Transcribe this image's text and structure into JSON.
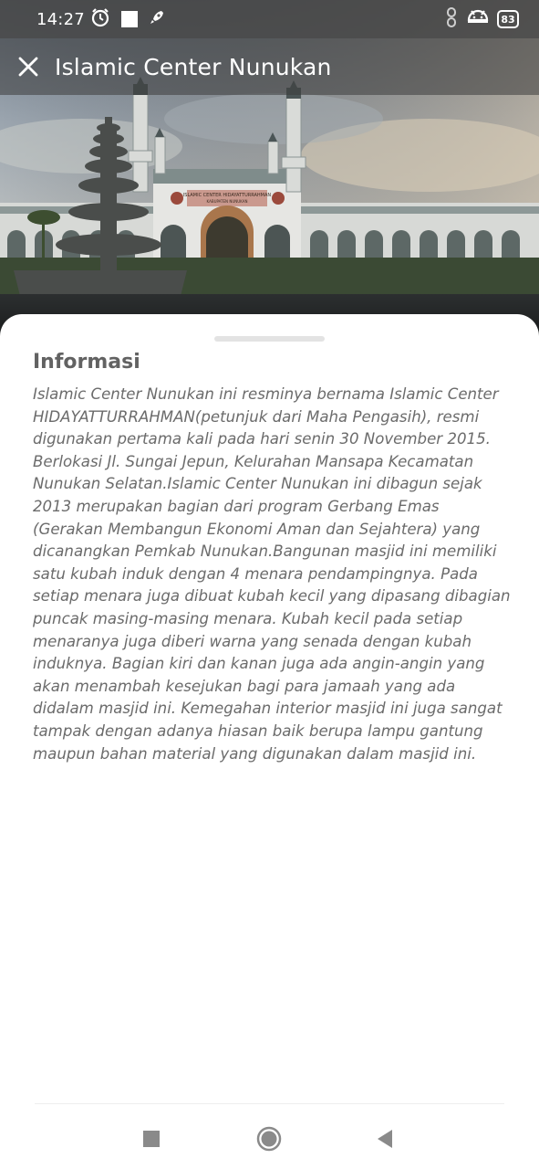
{
  "status_bar": {
    "time": "14:27",
    "icons": [
      "alarm-icon",
      "square-notification-icon",
      "rocket-icon",
      "link-icon",
      "android-icon"
    ],
    "battery": "83"
  },
  "app_bar": {
    "title": "Islamic Center Nunukan",
    "close_icon": "close-icon"
  },
  "hero": {
    "description": "photo of Islamic Center Nunukan mosque with fountain",
    "sign_text_1": "ISLAMIC CENTER HIDAYATTURRAHMAN",
    "sign_text_2": "KABUPATEN NUNUKAN"
  },
  "sheet": {
    "section_title": "Informasi",
    "body": "Islamic Center Nunukan ini resminya bernama Islamic Center HIDAYATTURRAHMAN(petunjuk dari Maha Pengasih), resmi digunakan pertama kali pada hari senin 30 November 2015. Berlokasi Jl. Sungai Jepun, Kelurahan Mansapa Kecamatan Nunukan Selatan.Islamic Center Nunukan ini dibagun sejak 2013 merupakan bagian dari program Gerbang Emas (Gerakan Membangun Ekonomi Aman dan Sejahtera) yang dicanangkan Pemkab Nunukan.Bangunan masjid ini memiliki satu kubah induk dengan 4 menara pendampingnya. Pada setiap menara juga dibuat kubah kecil yang dipasang dibagian puncak masing-masing menara. Kubah kecil pada setiap menaranya juga diberi warna yang senada dengan kubah induknya. Bagian kiri dan kanan juga ada angin-angin yang akan menambah kesejukan bagi para jamaah yang ada didalam masjid ini. Kemegahan interior masjid ini juga sangat tampak dengan adanya hiasan baik berupa lampu gantung maupun bahan material yang digunakan dalam masjid ini."
  },
  "nav_bar": {
    "icons": [
      "recents-square-icon",
      "home-circle-icon",
      "back-triangle-icon"
    ]
  },
  "colors": {
    "text": "#6b6b6b",
    "title": "#626262",
    "nav_icon": "#8a8a8a"
  }
}
